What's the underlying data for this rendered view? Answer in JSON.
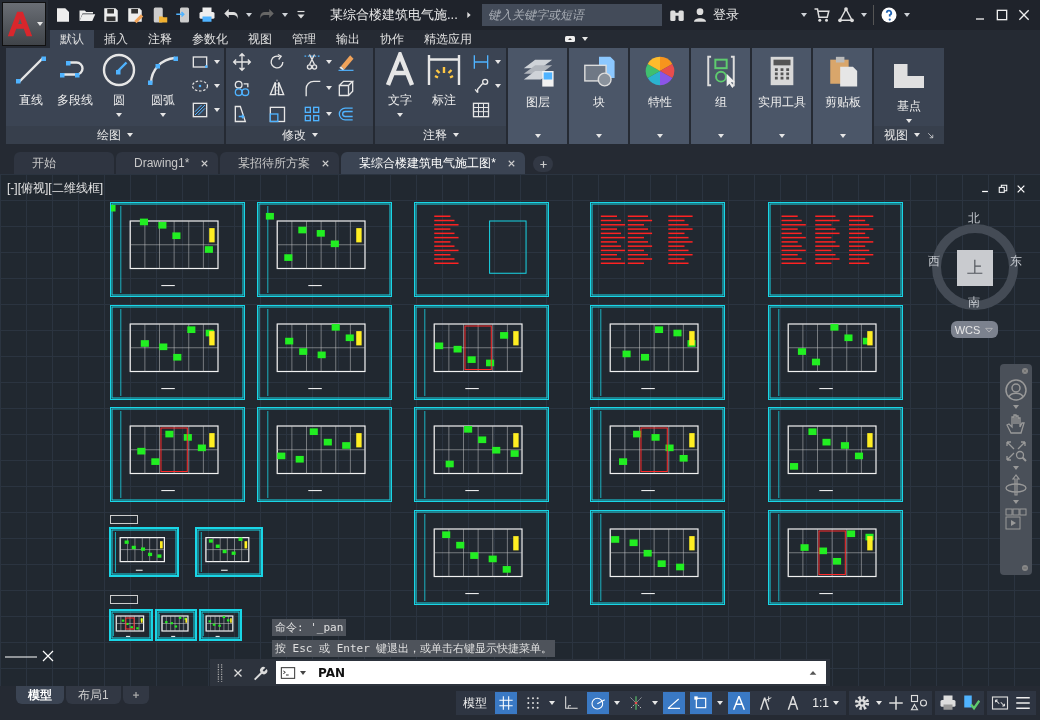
{
  "app": {
    "title": "某综合楼建筑电气施...",
    "search_placeholder": "键入关键字或短语",
    "user": "登录"
  },
  "ribbon_tabs": [
    {
      "label": "默认",
      "selected": true
    },
    {
      "label": "插入",
      "selected": false
    },
    {
      "label": "注释",
      "selected": false
    },
    {
      "label": "参数化",
      "selected": false
    },
    {
      "label": "视图",
      "selected": false
    },
    {
      "label": "管理",
      "selected": false
    },
    {
      "label": "输出",
      "selected": false
    },
    {
      "label": "协作",
      "selected": false
    },
    {
      "label": "精选应用",
      "selected": false
    }
  ],
  "panels": [
    {
      "kind": "draw",
      "title": "绘图",
      "tools": [
        "直线",
        "多段线",
        "圆",
        "圆弧"
      ]
    },
    {
      "kind": "modify",
      "title": "修改"
    },
    {
      "kind": "annotate",
      "title": "注释",
      "tools": [
        "文字",
        "标注"
      ]
    },
    {
      "kind": "large",
      "label": "图层"
    },
    {
      "kind": "large",
      "label": "块"
    },
    {
      "kind": "large",
      "label": "特性"
    },
    {
      "kind": "large",
      "label": "组"
    },
    {
      "kind": "large",
      "label": "实用工具"
    },
    {
      "kind": "large",
      "label": "剪贴板"
    },
    {
      "kind": "view",
      "title": "视图",
      "tools": [
        "基点"
      ]
    }
  ],
  "doc_tabs": [
    {
      "label": "开始",
      "selected": false,
      "closable": false
    },
    {
      "label": "Drawing1*",
      "selected": false,
      "closable": true
    },
    {
      "label": "某招待所方案",
      "selected": false,
      "closable": true
    },
    {
      "label": "某综合楼建筑电气施工图*",
      "selected": true,
      "closable": true
    }
  ],
  "viewport": {
    "label": "[-][俯视][二维线框]"
  },
  "viewcube": {
    "north": "北",
    "west": "西",
    "east": "东",
    "south": "南",
    "face": "上",
    "ucs": "WCS"
  },
  "command": {
    "history": [
      "命令: '_pan",
      "按 Esc 或 Enter 键退出，或单击右键显示快捷菜单。"
    ],
    "input": "PAN"
  },
  "status": {
    "layout_tabs": [
      {
        "label": "模型",
        "selected": true
      },
      {
        "label": "布局1",
        "selected": false
      }
    ],
    "model_label": "模型",
    "scale": "1:1",
    "toggles": [
      {
        "kind": "grid",
        "on": true
      },
      {
        "kind": "snap",
        "on": false
      },
      {
        "kind": "ortho",
        "on": false
      },
      {
        "kind": "polar",
        "on": true
      },
      {
        "kind": "track",
        "on": false
      },
      {
        "kind": "iso",
        "on": true
      },
      {
        "kind": "osnap",
        "on": true
      },
      {
        "kind": "annovis",
        "on": true
      },
      {
        "kind": "autoscale",
        "on": false
      },
      {
        "kind": "annoscale",
        "on": false
      }
    ]
  }
}
